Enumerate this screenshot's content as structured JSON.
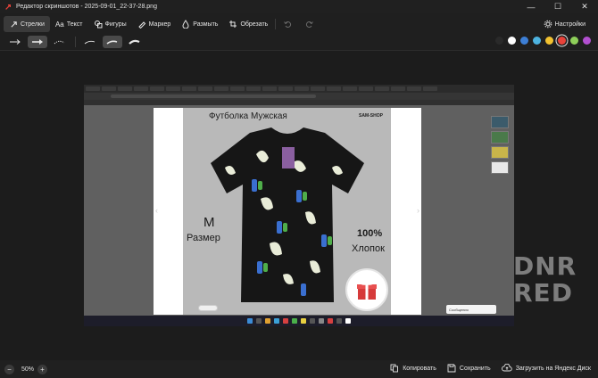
{
  "window": {
    "title": "Редактор скриншотов - 2025-09-01_22-37-28.png",
    "minimize": "—",
    "maximize": "☐",
    "close": "✕"
  },
  "toolbar": {
    "tools": [
      {
        "label": "Стрелки",
        "icon": "arrow-icon",
        "active": true
      },
      {
        "label": "Текст",
        "icon": "text-icon"
      },
      {
        "label": "Фигуры",
        "icon": "shapes-icon"
      },
      {
        "label": "Маркер",
        "icon": "marker-icon"
      },
      {
        "label": "Размыть",
        "icon": "blur-icon"
      },
      {
        "label": "Обрезать",
        "icon": "crop-icon"
      }
    ],
    "settings_label": "Настройки"
  },
  "colors": [
    "#2a2a2a",
    "#ffffff",
    "#3d7fd6",
    "#4db3e0",
    "#f2c230",
    "#e8423a",
    "#8ecf5a",
    "#b24fd0"
  ],
  "selected_color": "#e8423a",
  "product": {
    "title": "Футболка Мужская",
    "brand": "SAM-SHOP",
    "size_value": "M",
    "size_label": "Размер",
    "cotton_pct": "100%",
    "cotton_label": "Хлопок"
  },
  "browser": {
    "message_label": "Сообщения"
  },
  "watermark": {
    "line1": "DNR",
    "line2": "RED"
  },
  "bottom": {
    "zoom": "50%",
    "zoom_out": "−",
    "zoom_in": "+",
    "copy_label": "Копировать",
    "save_label": "Сохранить",
    "upload_label": "Загрузить на Яндекс Диск"
  }
}
